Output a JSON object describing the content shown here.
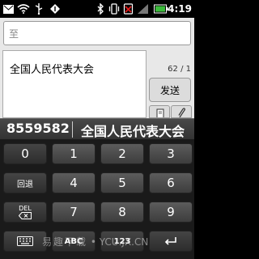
{
  "status_bar": {
    "time": "4:19",
    "icons": [
      "message-icon",
      "wifi-icon",
      "usb-icon",
      "debug-icon",
      "bluetooth-icon",
      "vibrate-icon",
      "no-sim-icon",
      "signal-icon",
      "battery-icon"
    ]
  },
  "compose": {
    "to_label": "至",
    "message_text": "全国人民代表大会",
    "counter": "62 / 1",
    "send_label": "发送"
  },
  "candidates": {
    "items": [
      "8559582",
      "全国人民代表大会"
    ]
  },
  "keyboard": {
    "rows": [
      [
        "0",
        "1",
        "2",
        "3"
      ],
      [
        "回退",
        "4",
        "5",
        "6"
      ],
      [
        "DEL",
        "7",
        "8",
        "9"
      ],
      [
        "",
        "ABC",
        "123",
        ""
      ]
    ],
    "sym_zero": "0",
    "sym_row4_label": "123"
  },
  "watermark": {
    "cn": "易趣下载",
    "url": "YCU.JX.CN"
  }
}
